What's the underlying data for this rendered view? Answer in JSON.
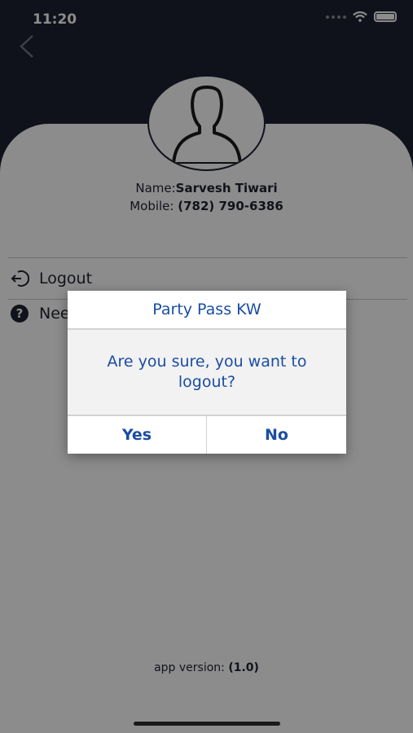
{
  "status_bar": {
    "time": "11:20"
  },
  "profile": {
    "name_label": "Name:",
    "name_value": "Sarvesh Tiwari",
    "mobile_label": "Mobile:",
    "mobile_value": "(782) 790-6386"
  },
  "menu": {
    "items": [
      {
        "label": "Logout",
        "icon": "logout-icon"
      },
      {
        "label": "Need Help?",
        "icon": "question-icon"
      }
    ]
  },
  "footer": {
    "version_label": "app version:",
    "version_value": "(1.0)"
  },
  "dialog": {
    "title": "Party Pass KW",
    "message": "Are you sure, you want to logout?",
    "yes_label": "Yes",
    "no_label": "No"
  },
  "colors": {
    "header": "#1d2232",
    "dialog_text": "#1a4da3",
    "background": "#ffffff"
  }
}
